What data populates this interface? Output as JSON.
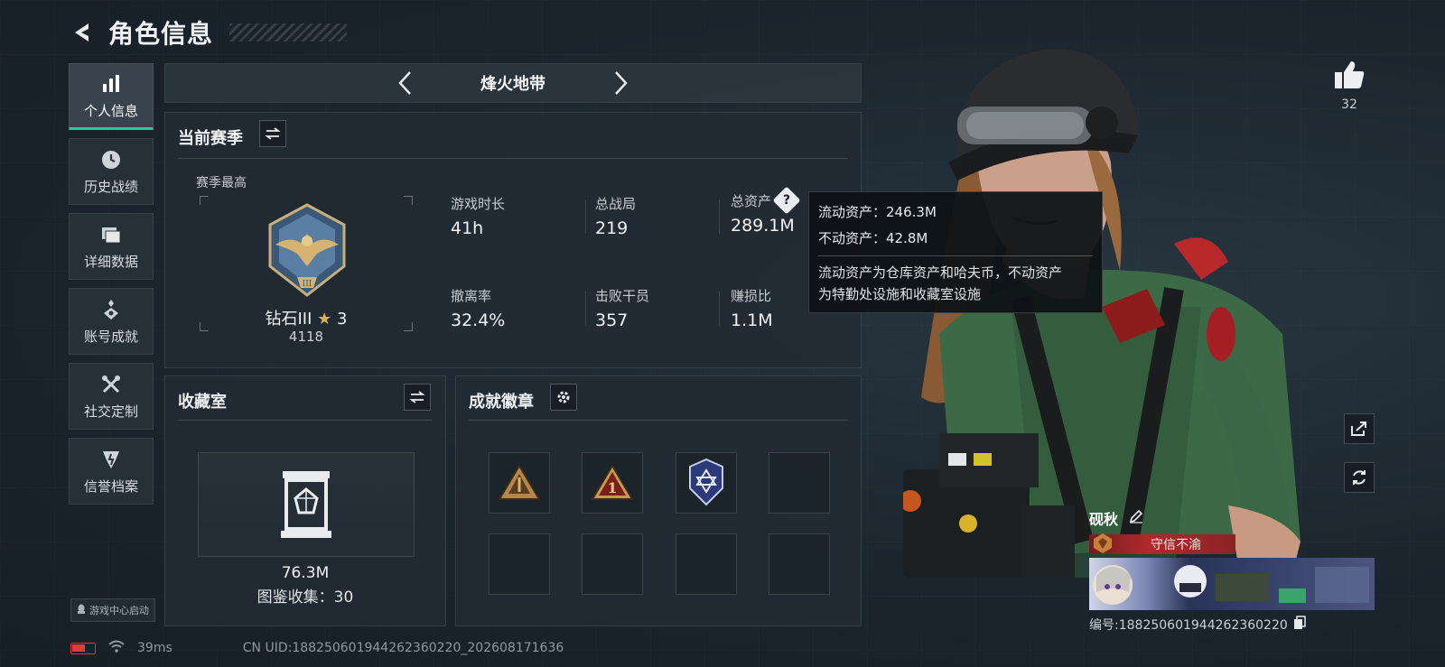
{
  "header": {
    "title": "角色信息"
  },
  "sidebar": {
    "items": [
      {
        "label": "个人信息",
        "icon": "bar-chart-icon",
        "active": true
      },
      {
        "label": "历史战绩",
        "icon": "clock-icon",
        "active": false
      },
      {
        "label": "详细数据",
        "icon": "folder-icon",
        "active": false
      },
      {
        "label": "账号成就",
        "icon": "achievement-icon",
        "active": false
      },
      {
        "label": "社交定制",
        "icon": "tools-icon",
        "active": false
      },
      {
        "label": "信誉档案",
        "icon": "shield-icon",
        "active": false
      }
    ],
    "launch_label": "游戏中心启动"
  },
  "mode": {
    "name": "烽火地带"
  },
  "season": {
    "title": "当前赛季",
    "best_label": "赛季最高",
    "rank_name": "钻石III",
    "rank_stars": "3",
    "rank_score": "4118",
    "stats": [
      {
        "label": "游戏时长",
        "value": "41h"
      },
      {
        "label": "总战局",
        "value": "219"
      },
      {
        "label": "总资产",
        "value": "289.1M"
      },
      {
        "label": "撤离率",
        "value": "32.4%"
      },
      {
        "label": "击败干员",
        "value": "357"
      },
      {
        "label": "赚损比",
        "value": "1.1M"
      }
    ]
  },
  "tooltip": {
    "liquid": "流动资产：246.3M",
    "fixed": "不动资产：42.8M",
    "desc_line1": "流动资产为仓库资产和哈夫币，不动资产",
    "desc_line2": "为特勤处设施和收藏室设施"
  },
  "collection": {
    "title": "收藏室",
    "value": "76.3M",
    "count": "图鉴收集：30"
  },
  "badges": {
    "title": "成就徽章",
    "slots": [
      "badge-triangle-gold",
      "badge-triangle-one",
      "badge-shield-blue",
      "",
      "",
      "",
      "",
      ""
    ]
  },
  "likes": {
    "count": "32"
  },
  "player": {
    "name": "砚秋",
    "title": "守信不渝",
    "id": "编号:1882506019442623602​20"
  },
  "status": {
    "ping": "39ms",
    "uid": "CN UID:1882506019442623602​20_202608171636"
  },
  "colors": {
    "accent": "#27c79a",
    "title_red": "#b0292c",
    "panel": "#222b33"
  }
}
